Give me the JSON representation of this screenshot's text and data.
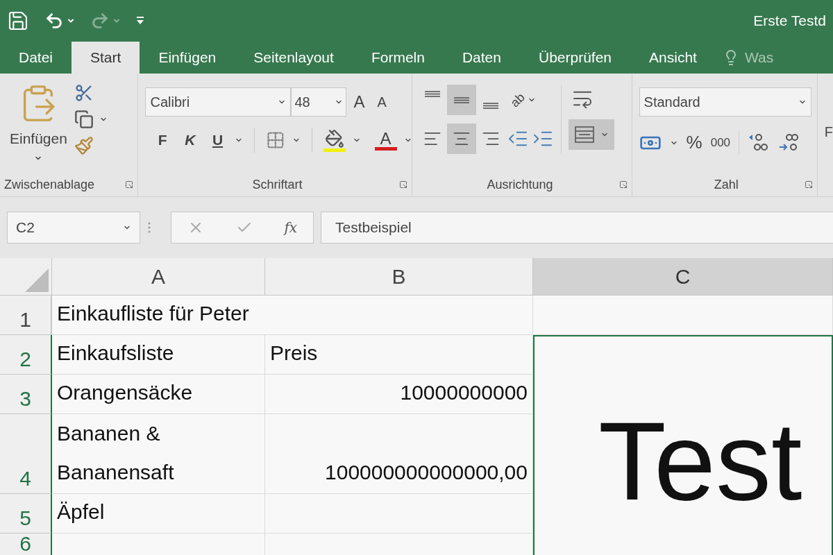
{
  "title": "Erste Testd",
  "tabs": [
    {
      "label": "Datei",
      "selected": false
    },
    {
      "label": "Start",
      "selected": true
    },
    {
      "label": "Einfügen",
      "selected": false
    },
    {
      "label": "Seitenlayout",
      "selected": false
    },
    {
      "label": "Formeln",
      "selected": false
    },
    {
      "label": "Daten",
      "selected": false
    },
    {
      "label": "Überprüfen",
      "selected": false
    },
    {
      "label": "Ansicht",
      "selected": false
    }
  ],
  "tell_me": "Was",
  "ribbon": {
    "clipboard": {
      "paste": "Einfügen",
      "group": "Zwischenablage"
    },
    "font": {
      "name": "Calibri",
      "size": "48",
      "grow": "A",
      "shrink": "A",
      "bold": "F",
      "italic": "K",
      "underline": "U",
      "font_color": "A",
      "group": "Schriftart"
    },
    "alignment": {
      "vertical": [
        {
          "kind": "top",
          "selected": false
        },
        {
          "kind": "middle",
          "selected": true
        },
        {
          "kind": "bottom",
          "selected": false
        }
      ],
      "orientation": "ab",
      "horizontal": [
        {
          "kind": "left",
          "selected": false
        },
        {
          "kind": "center",
          "selected": true
        },
        {
          "kind": "right",
          "selected": false
        }
      ],
      "merge_center": {
        "selected": true
      },
      "group": "Ausrichtung"
    },
    "number": {
      "format": "Standard",
      "percent": "%",
      "thousands": "000",
      "group": "Zahl"
    },
    "next_group": "F"
  },
  "formula_bar": {
    "name_box": "C2",
    "fx": "fx",
    "content": "Testbeispiel"
  },
  "columns": [
    {
      "label": "A",
      "selected": false
    },
    {
      "label": "B",
      "selected": false
    },
    {
      "label": "C",
      "selected": true
    }
  ],
  "rows": [
    {
      "header": "1",
      "selected": false,
      "cells": [
        {
          "kind": "text",
          "text": "Einkaufliste für Peter",
          "spills": true
        }
      ]
    },
    {
      "header": "2",
      "selected": true,
      "cells": [
        {
          "kind": "text",
          "text": "Einkaufsliste"
        },
        {
          "kind": "text",
          "text": "Preis"
        },
        {
          "kind": "merged",
          "text": "Test",
          "selected": true
        }
      ]
    },
    {
      "header": "3",
      "selected": true,
      "cells": [
        {
          "kind": "text",
          "text": "Orangensäcke"
        },
        {
          "kind": "number",
          "text": "10000000000"
        }
      ]
    },
    {
      "header": "4",
      "selected": true,
      "cells": [
        {
          "kind": "text",
          "text": "Bananen & Bananensaft"
        },
        {
          "kind": "number",
          "text": "100000000000000,00"
        }
      ]
    },
    {
      "header": "5",
      "selected": true,
      "cells": [
        {
          "kind": "text",
          "text": "Äpfel"
        }
      ]
    },
    {
      "header": "6",
      "selected": true,
      "cells": []
    }
  ]
}
